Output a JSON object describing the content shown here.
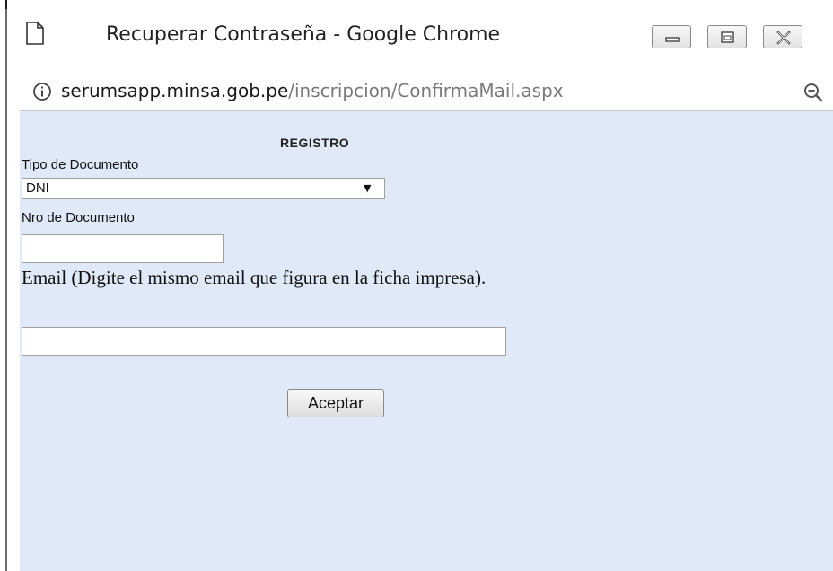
{
  "window": {
    "title": "Recuperar Contraseña - Google Chrome",
    "minimize_icon": "minimize-icon",
    "maximize_icon": "maximize-icon",
    "close_icon": "close-icon",
    "page_icon": "page-icon"
  },
  "address_bar": {
    "info_icon": "info-icon",
    "url_host": "serumsapp.minsa.gob.pe",
    "url_path": "/inscripcion/ConfirmaMail.aspx",
    "zoom_icon": "zoom-out-icon"
  },
  "form": {
    "heading": "REGISTRO",
    "tipo_label": "Tipo de Documento",
    "tipo_value": "DNI",
    "nro_label": "Nro de Documento",
    "nro_value": "",
    "email_label": "Email (Digite el mismo email que figura en la ficha impresa).",
    "email_value": "",
    "submit_label": "Aceptar"
  },
  "colors": {
    "page_background": "#e0e9f7",
    "url_host": "#1a1a1a",
    "url_path": "#7a7a7a"
  }
}
